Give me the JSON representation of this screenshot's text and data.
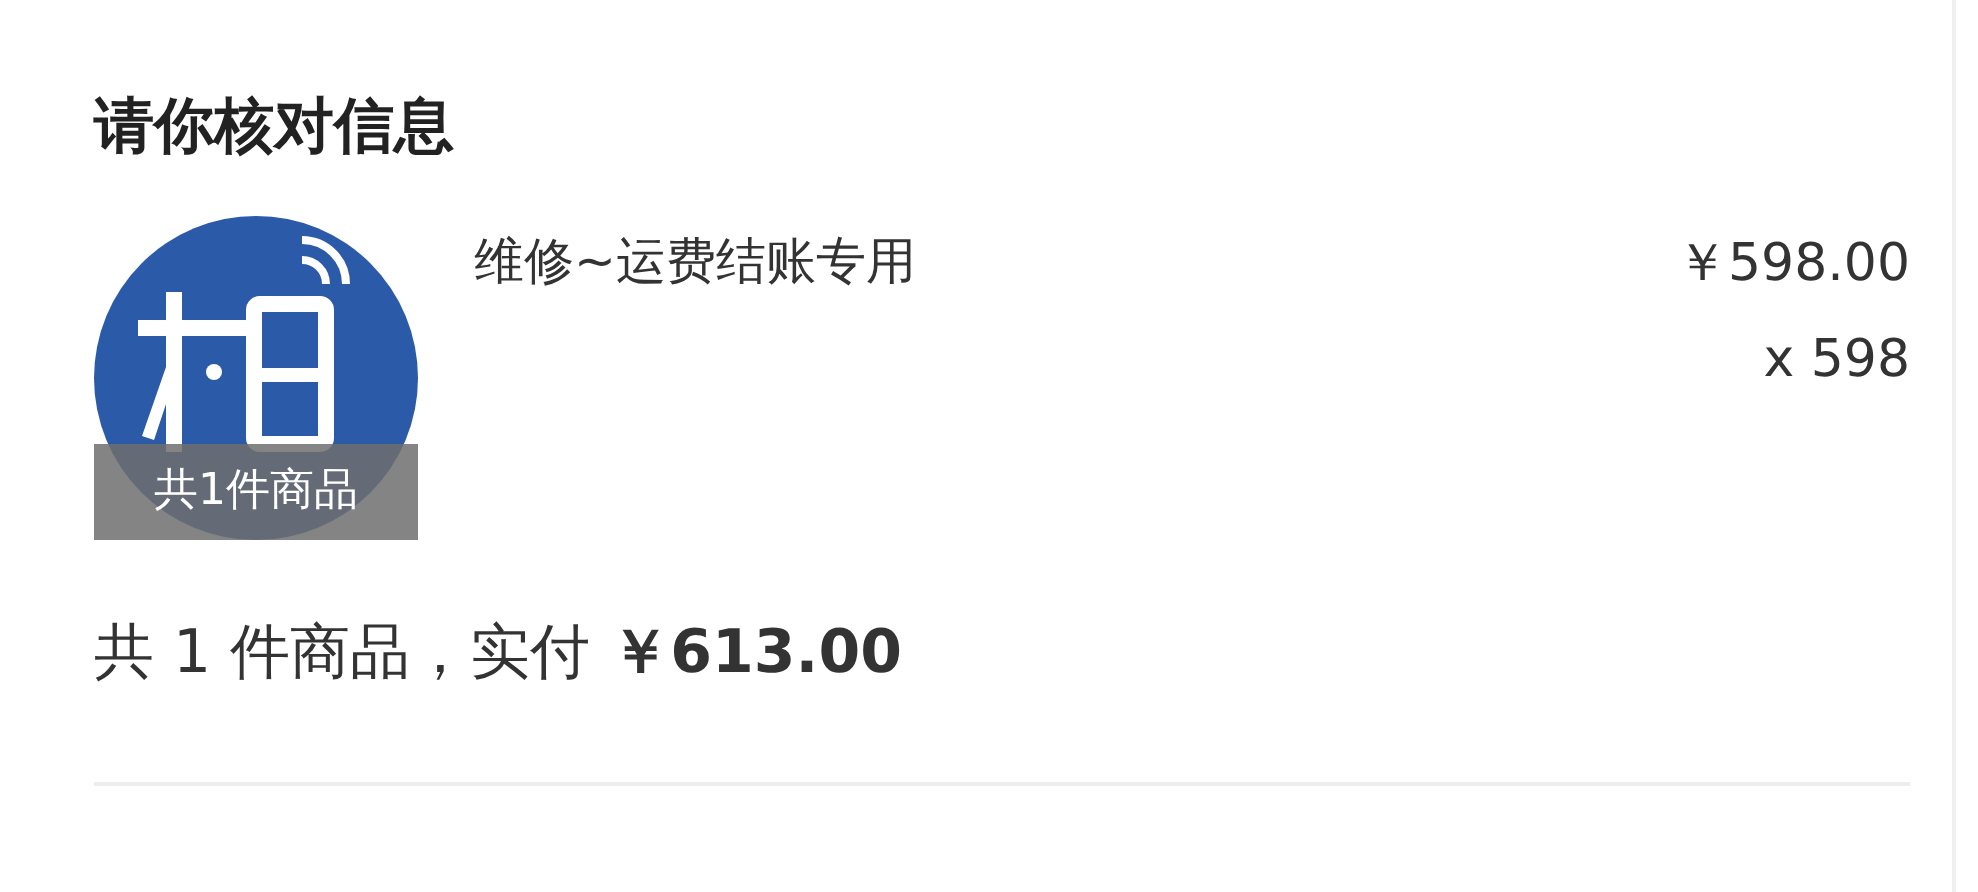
{
  "title": "请你核对信息",
  "item": {
    "thumbnail_caption": "共1件商品",
    "name": "维修~运费结账专用",
    "price": "￥598.00",
    "quantity": "x 598"
  },
  "summary": {
    "text": "共 1 件商品，实付",
    "total": "￥613.00"
  }
}
